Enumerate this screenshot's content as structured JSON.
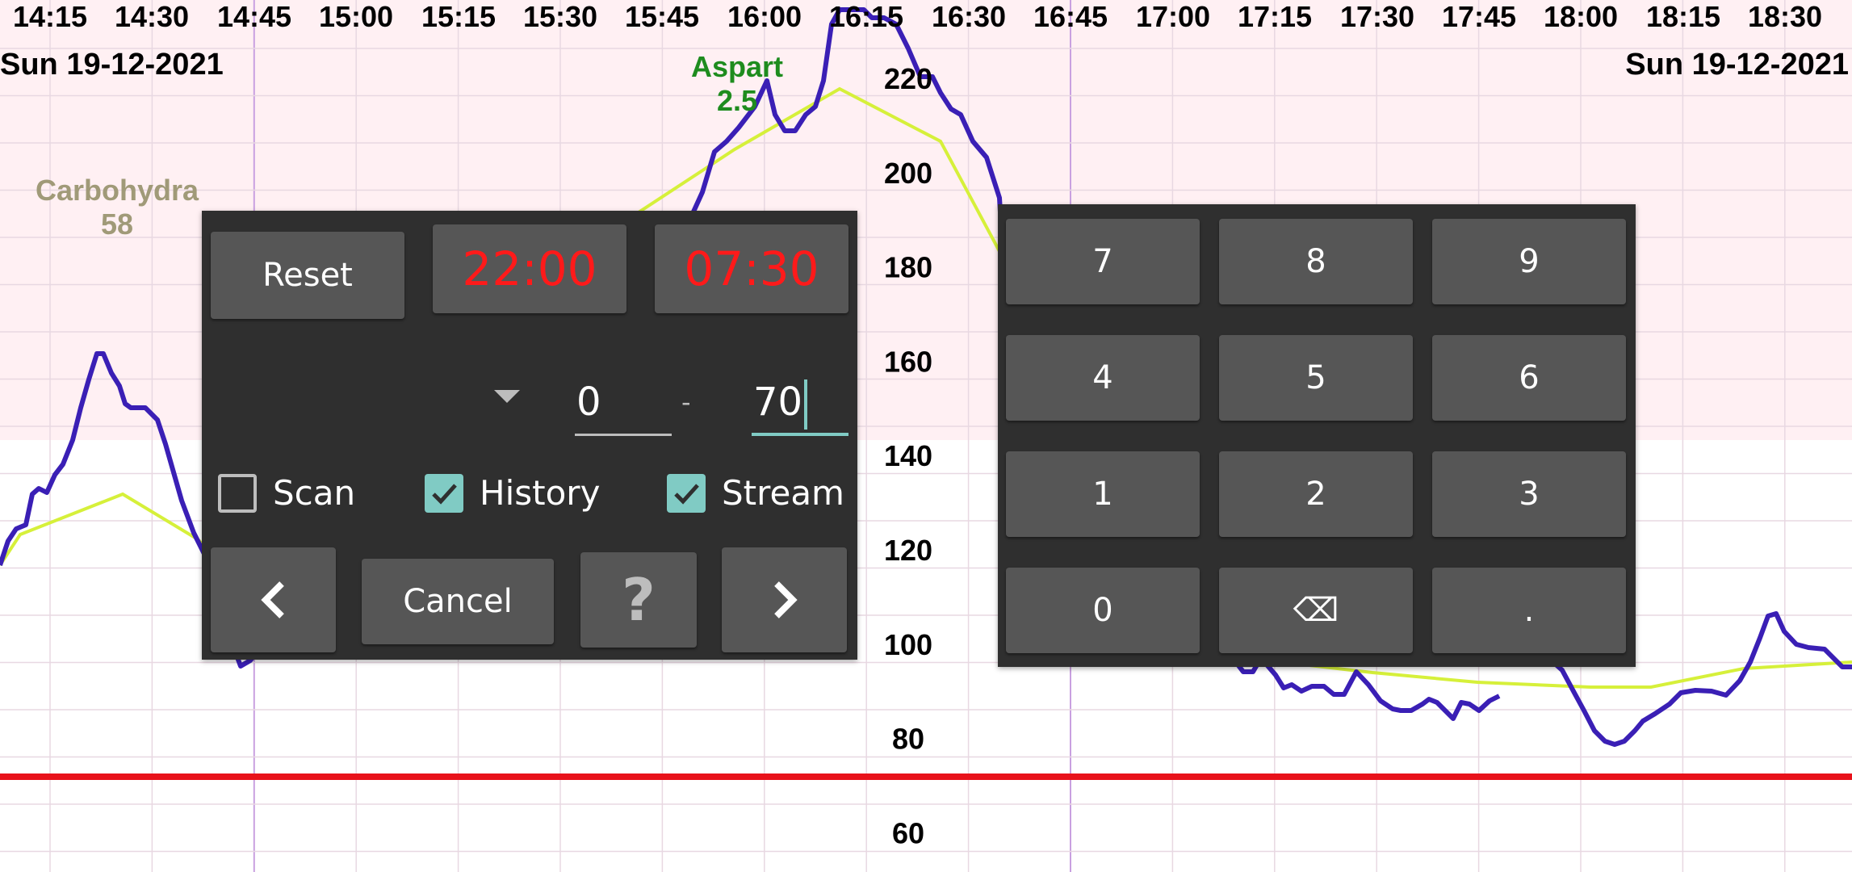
{
  "graph": {
    "time_labels": [
      "14:15",
      "14:30",
      "14:45",
      "15:00",
      "15:15",
      "15:30",
      "15:45",
      "16:00",
      "16:15",
      "16:30",
      "16:45",
      "17:00",
      "17:15",
      "17:30",
      "17:45",
      "18:00",
      "18:15",
      "18:30"
    ],
    "date_left": "Sun 19-12-2021",
    "date_right": "Sun 19-12-2021",
    "y_labels": [
      "220",
      "200",
      "180",
      "160",
      "140",
      "120",
      "100",
      "80",
      "60"
    ],
    "annotations": {
      "carbs_label": "Carbohydra",
      "carbs_value": "58",
      "insulin_label": "Aspart",
      "insulin_value": "2.5"
    },
    "colors": {
      "glucose_line": "#3a1fb5",
      "trend_line": "#d6f03a",
      "low_line": "#e8121b",
      "high_zone": "#fff0f3",
      "carbs_text": "#a09a78",
      "insulin_text": "#1e8c1e",
      "grid": "#e8d8e2",
      "hour_line": "#c9a0e0"
    }
  },
  "dialog": {
    "reset_label": "Reset",
    "start_time": "22:00",
    "end_time": "07:30",
    "range_min": "0",
    "range_separator": "-",
    "range_max": "70",
    "dropdown_icon": "triangle-down",
    "checkboxes": [
      {
        "label": "Scan",
        "checked": false
      },
      {
        "label": "History",
        "checked": true
      },
      {
        "label": "Stream",
        "checked": true
      }
    ],
    "prev_icon": "chevron-left",
    "cancel_label": "Cancel",
    "help_label": "?",
    "next_icon": "chevron-right",
    "accent_color": "#80cbc4",
    "time_color": "#ff1a1a"
  },
  "keypad": {
    "keys": [
      "7",
      "8",
      "9",
      "4",
      "5",
      "6",
      "1",
      "2",
      "3",
      "0",
      "⌫",
      "."
    ]
  }
}
